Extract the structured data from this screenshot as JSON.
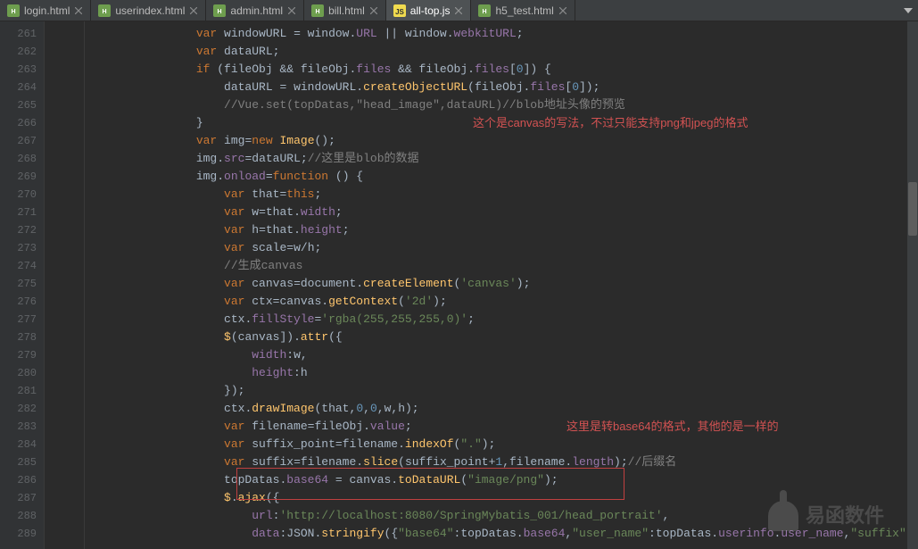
{
  "tabs": [
    {
      "label": "login.html",
      "type": "html",
      "active": false
    },
    {
      "label": "userindex.html",
      "type": "html",
      "active": false
    },
    {
      "label": "admin.html",
      "type": "html",
      "active": false
    },
    {
      "label": "bill.html",
      "type": "html",
      "active": false
    },
    {
      "label": "all-top.js",
      "type": "js",
      "active": true
    },
    {
      "label": "h5_test.html",
      "type": "html",
      "active": false
    }
  ],
  "gutter": {
    "start": 261,
    "end": 289
  },
  "annotations": {
    "hint1": "这个是canvas的写法，不过只能支持png和jpeg的格式",
    "hint2": "这里是转base64的格式，其他的是一样的"
  },
  "watermark": "易函数件",
  "code": [
    {
      "indent": 16,
      "segs": [
        [
          "kw",
          "var "
        ],
        [
          "ident",
          "windowURL "
        ],
        [
          "plain",
          "= "
        ],
        [
          "ident",
          "window"
        ],
        [
          "plain",
          "."
        ],
        [
          "prop",
          "URL"
        ],
        [
          "plain",
          " || "
        ],
        [
          "ident",
          "window"
        ],
        [
          "plain",
          "."
        ],
        [
          "prop",
          "webkitURL"
        ],
        [
          "plain",
          ";"
        ]
      ]
    },
    {
      "indent": 16,
      "segs": [
        [
          "kw",
          "var "
        ],
        [
          "ident",
          "dataURL"
        ],
        [
          "plain",
          ";"
        ]
      ]
    },
    {
      "indent": 16,
      "segs": [
        [
          "kw",
          "if "
        ],
        [
          "plain",
          "("
        ],
        [
          "ident",
          "fileObj"
        ],
        [
          "plain",
          " && "
        ],
        [
          "ident",
          "fileObj"
        ],
        [
          "plain",
          "."
        ],
        [
          "prop",
          "files"
        ],
        [
          "plain",
          " && "
        ],
        [
          "ident",
          "fileObj"
        ],
        [
          "plain",
          "."
        ],
        [
          "prop",
          "files"
        ],
        [
          "plain",
          "["
        ],
        [
          "num",
          "0"
        ],
        [
          "plain",
          "]) {"
        ]
      ]
    },
    {
      "indent": 20,
      "segs": [
        [
          "ident",
          "dataURL "
        ],
        [
          "plain",
          "= "
        ],
        [
          "ident",
          "windowURL"
        ],
        [
          "plain",
          "."
        ],
        [
          "func",
          "createObjectURL"
        ],
        [
          "plain",
          "("
        ],
        [
          "ident",
          "fileObj"
        ],
        [
          "plain",
          "."
        ],
        [
          "prop",
          "files"
        ],
        [
          "plain",
          "["
        ],
        [
          "num",
          "0"
        ],
        [
          "plain",
          "]);"
        ]
      ]
    },
    {
      "indent": 20,
      "segs": [
        [
          "comment",
          "//Vue.set(topDatas,\"head_image\",dataURL)//blob地址头像的预览"
        ]
      ]
    },
    {
      "indent": 16,
      "segs": [
        [
          "plain",
          "}"
        ]
      ]
    },
    {
      "indent": 16,
      "segs": [
        [
          "kw",
          "var "
        ],
        [
          "ident",
          "img"
        ],
        [
          "plain",
          "="
        ],
        [
          "kw",
          "new "
        ],
        [
          "func",
          "Image"
        ],
        [
          "plain",
          "();"
        ]
      ]
    },
    {
      "indent": 16,
      "segs": [
        [
          "ident",
          "img"
        ],
        [
          "plain",
          "."
        ],
        [
          "prop",
          "src"
        ],
        [
          "plain",
          "="
        ],
        [
          "ident",
          "dataURL"
        ],
        [
          "plain",
          ";"
        ],
        [
          "comment",
          "//这里是blob的数据"
        ]
      ]
    },
    {
      "indent": 16,
      "segs": [
        [
          "ident",
          "img"
        ],
        [
          "plain",
          "."
        ],
        [
          "prop",
          "onload"
        ],
        [
          "plain",
          "="
        ],
        [
          "kw",
          "function "
        ],
        [
          "plain",
          "() {"
        ]
      ]
    },
    {
      "indent": 20,
      "segs": [
        [
          "kw",
          "var "
        ],
        [
          "ident",
          "that"
        ],
        [
          "plain",
          "="
        ],
        [
          "kw",
          "this"
        ],
        [
          "plain",
          ";"
        ]
      ]
    },
    {
      "indent": 20,
      "segs": [
        [
          "kw",
          "var "
        ],
        [
          "ident",
          "w"
        ],
        [
          "plain",
          "="
        ],
        [
          "ident",
          "that"
        ],
        [
          "plain",
          "."
        ],
        [
          "prop",
          "width"
        ],
        [
          "plain",
          ";"
        ]
      ]
    },
    {
      "indent": 20,
      "segs": [
        [
          "kw",
          "var "
        ],
        [
          "ident",
          "h"
        ],
        [
          "plain",
          "="
        ],
        [
          "ident",
          "that"
        ],
        [
          "plain",
          "."
        ],
        [
          "prop",
          "height"
        ],
        [
          "plain",
          ";"
        ]
      ]
    },
    {
      "indent": 20,
      "segs": [
        [
          "kw",
          "var "
        ],
        [
          "ident",
          "scale"
        ],
        [
          "plain",
          "="
        ],
        [
          "ident",
          "w"
        ],
        [
          "plain",
          "/"
        ],
        [
          "ident",
          "h"
        ],
        [
          "plain",
          ";"
        ]
      ]
    },
    {
      "indent": 20,
      "segs": [
        [
          "comment",
          "//生成canvas"
        ]
      ]
    },
    {
      "indent": 20,
      "segs": [
        [
          "kw",
          "var "
        ],
        [
          "ident",
          "canvas"
        ],
        [
          "plain",
          "="
        ],
        [
          "ident",
          "document"
        ],
        [
          "plain",
          "."
        ],
        [
          "func",
          "createElement"
        ],
        [
          "plain",
          "("
        ],
        [
          "str",
          "'canvas'"
        ],
        [
          "plain",
          ");"
        ]
      ]
    },
    {
      "indent": 20,
      "segs": [
        [
          "kw",
          "var "
        ],
        [
          "ident",
          "ctx"
        ],
        [
          "plain",
          "="
        ],
        [
          "ident",
          "canvas"
        ],
        [
          "plain",
          "."
        ],
        [
          "func",
          "getContext"
        ],
        [
          "plain",
          "("
        ],
        [
          "str",
          "'2d'"
        ],
        [
          "plain",
          ");"
        ]
      ]
    },
    {
      "indent": 20,
      "segs": [
        [
          "ident",
          "ctx"
        ],
        [
          "plain",
          "."
        ],
        [
          "prop",
          "fillStyle"
        ],
        [
          "plain",
          "="
        ],
        [
          "str",
          "'rgba(255,255,255,0)'"
        ],
        [
          "plain",
          ";"
        ]
      ]
    },
    {
      "indent": 20,
      "segs": [
        [
          "func",
          "$"
        ],
        [
          "plain",
          "("
        ],
        [
          "ident",
          "canvas"
        ],
        [
          "plain",
          "])."
        ],
        [
          "func",
          "attr"
        ],
        [
          "plain",
          "({"
        ]
      ]
    },
    {
      "indent": 24,
      "segs": [
        [
          "prop",
          "width"
        ],
        [
          "plain",
          ":"
        ],
        [
          "ident",
          "w"
        ],
        [
          "plain",
          ","
        ]
      ]
    },
    {
      "indent": 24,
      "segs": [
        [
          "prop",
          "height"
        ],
        [
          "plain",
          ":"
        ],
        [
          "ident",
          "h"
        ]
      ]
    },
    {
      "indent": 20,
      "segs": [
        [
          "plain",
          "});"
        ]
      ]
    },
    {
      "indent": 20,
      "segs": [
        [
          "ident",
          "ctx"
        ],
        [
          "plain",
          "."
        ],
        [
          "func",
          "drawImage"
        ],
        [
          "plain",
          "("
        ],
        [
          "ident",
          "that"
        ],
        [
          "plain",
          ","
        ],
        [
          "num",
          "0"
        ],
        [
          "plain",
          ","
        ],
        [
          "num",
          "0"
        ],
        [
          "plain",
          ","
        ],
        [
          "ident",
          "w"
        ],
        [
          "plain",
          ","
        ],
        [
          "ident",
          "h"
        ],
        [
          "plain",
          ");"
        ]
      ]
    },
    {
      "indent": 20,
      "segs": [
        [
          "kw",
          "var "
        ],
        [
          "ident",
          "filename"
        ],
        [
          "plain",
          "="
        ],
        [
          "ident",
          "fileObj"
        ],
        [
          "plain",
          "."
        ],
        [
          "prop",
          "value"
        ],
        [
          "plain",
          ";"
        ]
      ]
    },
    {
      "indent": 20,
      "segs": [
        [
          "kw",
          "var "
        ],
        [
          "ident",
          "suffix_point"
        ],
        [
          "plain",
          "="
        ],
        [
          "ident",
          "filename"
        ],
        [
          "plain",
          "."
        ],
        [
          "func",
          "indexOf"
        ],
        [
          "plain",
          "("
        ],
        [
          "str",
          "\".\""
        ],
        [
          "plain",
          ");"
        ]
      ]
    },
    {
      "indent": 20,
      "segs": [
        [
          "kw",
          "var "
        ],
        [
          "ident",
          "suffix"
        ],
        [
          "plain",
          "="
        ],
        [
          "ident",
          "filename"
        ],
        [
          "plain",
          "."
        ],
        [
          "func",
          "slice"
        ],
        [
          "plain",
          "("
        ],
        [
          "ident",
          "suffix_point"
        ],
        [
          "plain",
          "+"
        ],
        [
          "num",
          "1"
        ],
        [
          "plain",
          ","
        ],
        [
          "ident",
          "filename"
        ],
        [
          "plain",
          "."
        ],
        [
          "prop",
          "length"
        ],
        [
          "plain",
          ");"
        ],
        [
          "comment",
          "//后缀名"
        ]
      ]
    },
    {
      "indent": 20,
      "segs": [
        [
          "ident",
          "topDatas"
        ],
        [
          "plain",
          "."
        ],
        [
          "prop",
          "base64"
        ],
        [
          "plain",
          " = "
        ],
        [
          "ident",
          "canvas"
        ],
        [
          "plain",
          "."
        ],
        [
          "func",
          "toDataURL"
        ],
        [
          "plain",
          "("
        ],
        [
          "str",
          "\"image/png\""
        ],
        [
          "plain",
          ");"
        ]
      ]
    },
    {
      "indent": 20,
      "segs": [
        [
          "func",
          "$"
        ],
        [
          "plain",
          "."
        ],
        [
          "func",
          "ajax"
        ],
        [
          "plain",
          "({"
        ]
      ]
    },
    {
      "indent": 24,
      "segs": [
        [
          "prop",
          "url"
        ],
        [
          "plain",
          ":"
        ],
        [
          "str",
          "'http://localhost:8080/SpringMybatis_001/head_portrait'"
        ],
        [
          "plain",
          ","
        ]
      ]
    },
    {
      "indent": 24,
      "segs": [
        [
          "prop",
          "data"
        ],
        [
          "plain",
          ":"
        ],
        [
          "ident",
          "JSON"
        ],
        [
          "plain",
          "."
        ],
        [
          "func",
          "stringify"
        ],
        [
          "plain",
          "({"
        ],
        [
          "str",
          "\"base64\""
        ],
        [
          "plain",
          ":"
        ],
        [
          "ident",
          "topDatas"
        ],
        [
          "plain",
          "."
        ],
        [
          "prop",
          "base64"
        ],
        [
          "plain",
          ","
        ],
        [
          "str",
          "\"user_name\""
        ],
        [
          "plain",
          ":"
        ],
        [
          "ident",
          "topDatas"
        ],
        [
          "plain",
          "."
        ],
        [
          "prop",
          "userinfo"
        ],
        [
          "plain",
          "."
        ],
        [
          "prop",
          "user_name"
        ],
        [
          "plain",
          ","
        ],
        [
          "str",
          "\"suffix\""
        ]
      ]
    }
  ]
}
